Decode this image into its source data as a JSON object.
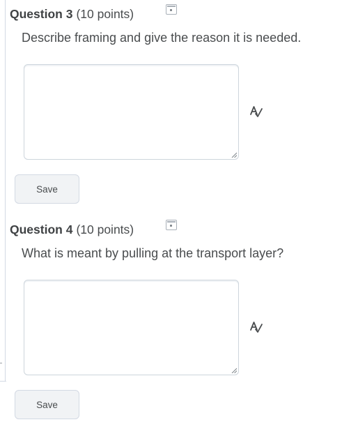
{
  "questions": [
    {
      "title": "Question 3",
      "points": "(10 points)",
      "prompt": "Describe framing and give the reason it is needed.",
      "answer": "",
      "save_label": "Save"
    },
    {
      "title": "Question 4",
      "points": "(10 points)",
      "prompt": "What is meant by pulling at the transport layer?",
      "answer": "",
      "save_label": "Save"
    }
  ],
  "icons": {
    "flag": "flag-question-icon",
    "spellcheck": "spellcheck-icon",
    "resize": "resize-grip-icon"
  },
  "colors": {
    "text": "#494c4e",
    "border": "#cdd5dc",
    "button_bg": "#f1f3f5"
  }
}
